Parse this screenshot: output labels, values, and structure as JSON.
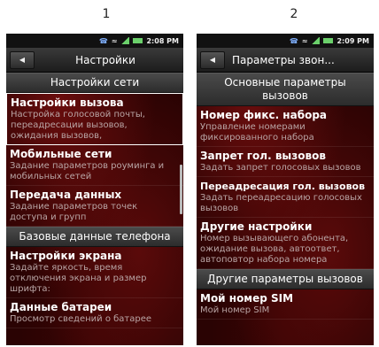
{
  "labels": {
    "first": "1",
    "second": "2"
  },
  "status": {
    "time1": "2:08 PM",
    "time2": "2:09 PM"
  },
  "screen1": {
    "title": "Настройки",
    "section1": "Настройки сети",
    "items": [
      {
        "title": "Настройки вызова",
        "sub": "Настройка голосовой почты, переадресации вызовов, ожидания вызовов,"
      },
      {
        "title": "Мобильные сети",
        "sub": "Задание параметров роуминга и мобильных сетей"
      },
      {
        "title": "Передача данных",
        "sub": "Задание параметров точек доступа и групп"
      }
    ],
    "section2": "Базовые данные телефона",
    "items2": [
      {
        "title": "Настройки экрана",
        "sub": "Задайте яркость, время отключения экрана и размер шрифта:"
      },
      {
        "title": "Данные батареи",
        "sub": "Просмотр сведений о батарее"
      }
    ]
  },
  "screen2": {
    "title": "Параметры звон...",
    "section1": "Основные параметры вызовов",
    "items": [
      {
        "title": "Номер фикс. набора",
        "sub": "Управление номерами фиксированного набора"
      },
      {
        "title": "Запрет гол. вызовов",
        "sub": "Задать запрет голосовых вызовов"
      },
      {
        "title": "Переадресация гол. вызовов",
        "sub": "Задать переадресацию голосовых вызовов"
      },
      {
        "title": "Другие настройки",
        "sub": "Номер вызывающего абонента, ожидание вызова, автоответ, автоповтор набора номера"
      }
    ],
    "section2": "Другие параметры вызовов",
    "items2": [
      {
        "title": "Мой номер SIM",
        "sub": "Мой номер SIM"
      }
    ]
  },
  "icons": [
    "back-arrow-icon",
    "phone-icon",
    "wifi-icon",
    "signal-icon",
    "battery-icon"
  ],
  "colors": {
    "accent_background": "#2a0303",
    "header_bar": "#3a3a3a",
    "text_primary": "#ffffff",
    "text_secondary": "#b9a5a5"
  }
}
